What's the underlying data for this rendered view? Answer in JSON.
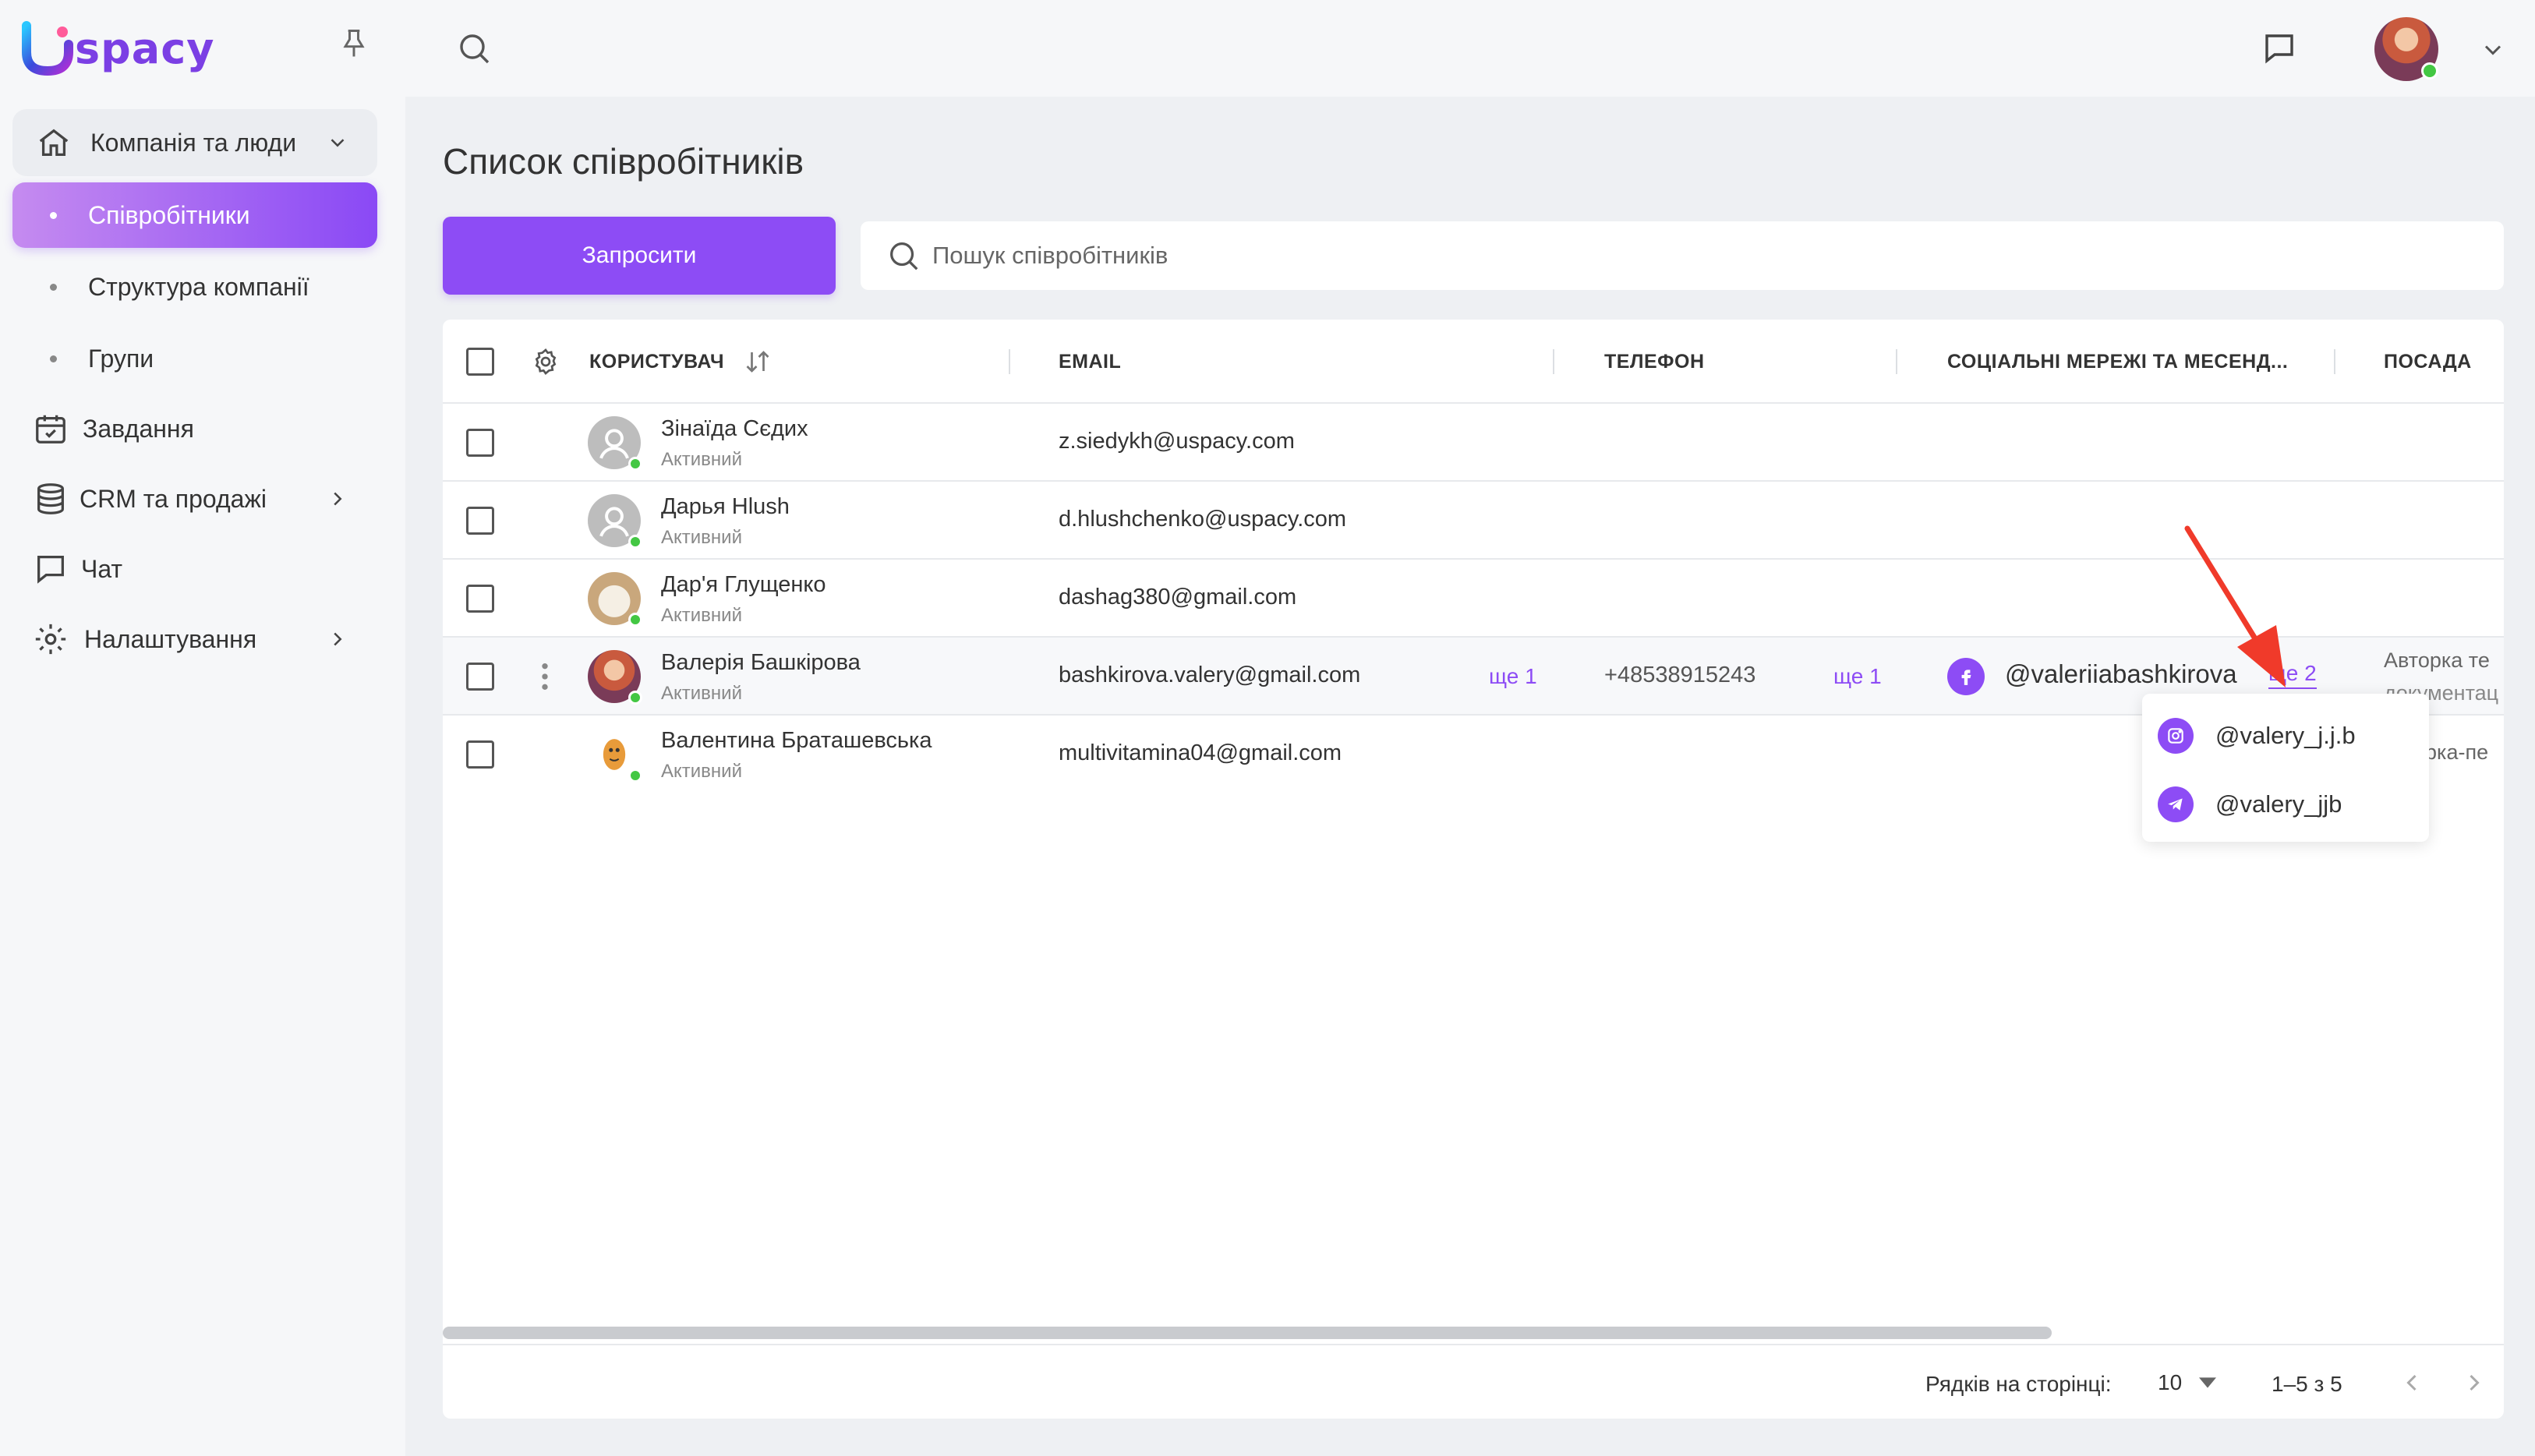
{
  "app": {
    "logo_text": "spacy"
  },
  "sidebar": {
    "group": {
      "label": "Компанія та люди"
    },
    "subitems": [
      {
        "label": "Співробітники",
        "active": true
      },
      {
        "label": "Структура компанії"
      },
      {
        "label": "Групи"
      }
    ],
    "items": [
      {
        "label": "Завдання",
        "icon": "calendar-icon"
      },
      {
        "label": "CRM та продажі",
        "icon": "database-icon"
      },
      {
        "label": "Чат",
        "icon": "chat-icon"
      },
      {
        "label": "Налаштування",
        "icon": "gear-icon"
      }
    ]
  },
  "page": {
    "title": "Список співробітників",
    "invite_label": "Запросити",
    "search_placeholder": "Пошук співробітників"
  },
  "table": {
    "headers": {
      "user": "КОРИСТУВАЧ",
      "email": "EMAIL",
      "phone": "ТЕЛЕФОН",
      "social": "СОЦІАЛЬНІ МЕРЕЖІ ТА МЕСЕНД...",
      "position": "ПОСАДА"
    },
    "rows": [
      {
        "name": "Зінаїда Сєдих",
        "status": "Активний",
        "email": "z.siedykh@uspacy.com"
      },
      {
        "name": "Дарья Hlush",
        "status": "Активний",
        "email": "d.hlushchenko@uspacy.com"
      },
      {
        "name": "Дар'я Глущенко",
        "status": "Активний",
        "email": "dashag380@gmail.com"
      },
      {
        "name": "Валерія Башкірова",
        "status": "Активний",
        "email": "bashkirova.valery@gmail.com",
        "email_more": "ще 1",
        "phone": "+48538915243",
        "phone_more": "ще 1",
        "social": "@valeriiabashkirova",
        "social_more": "ще 2",
        "position": "Авторка те",
        "position_line2": "документац"
      },
      {
        "name": "Валентина Браташевська",
        "status": "Активний",
        "email": "multivitamina04@gmail.com",
        "position": "орка-пе"
      }
    ]
  },
  "popup": {
    "items": [
      {
        "label": "@valery_j.j.b",
        "icon": "instagram-icon"
      },
      {
        "label": "@valery_jjb",
        "icon": "telegram-icon"
      }
    ]
  },
  "footer": {
    "rows_per_page_label": "Рядків на сторінці:",
    "rows_per_page_value": "10",
    "range": "1–5 з 5"
  },
  "colors": {
    "accent": "#8d4cf5",
    "online": "#43c743"
  }
}
